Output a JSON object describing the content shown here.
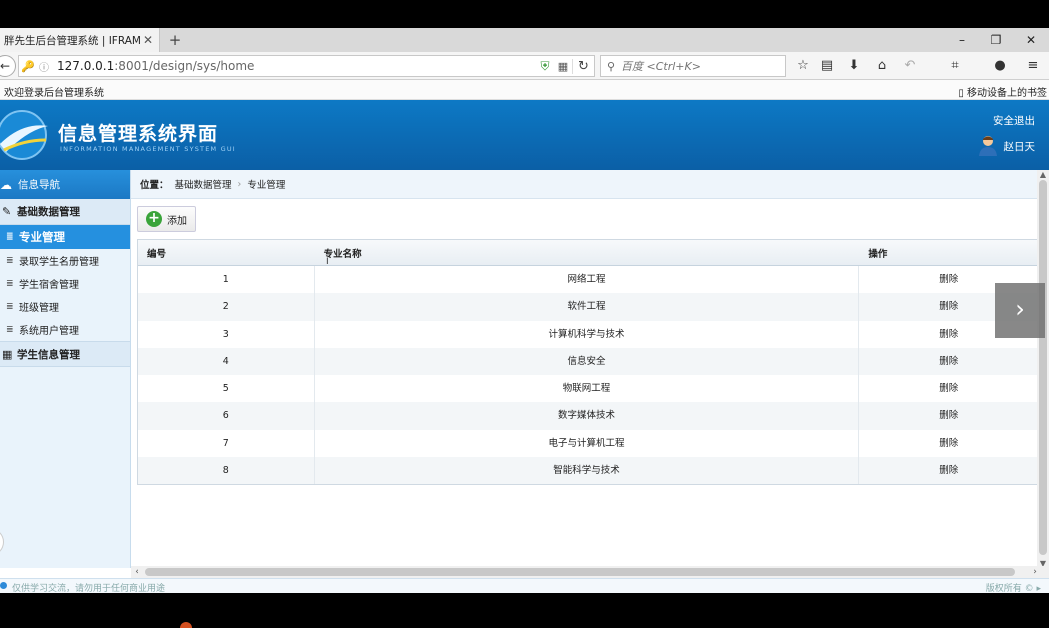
{
  "browser": {
    "tab_title": "胖先生后台管理系统 | IFRAM...",
    "tab_close": "✕",
    "new_tab": "+",
    "window_controls": [
      "–",
      "❐",
      "✕"
    ],
    "url_host": "127.0.0.1",
    "url_rest": ":8001/design/sys/home",
    "search_placeholder": "百度 <Ctrl+K>",
    "bookmark_left": "欢迎登录后台管理系统",
    "bookmark_right": "移动设备上的书签"
  },
  "header": {
    "title": "信息管理系统界面",
    "subtitle": "INFORMATION MANAGEMENT SYSTEM GUI",
    "logout": "安全退出",
    "user_name": "赵日天"
  },
  "sidebar": {
    "nav_title": "信息导航",
    "group1_title": "基础数据管理",
    "items": [
      {
        "label": "专业管理",
        "active": true
      },
      {
        "label": "录取学生名册管理",
        "active": false
      },
      {
        "label": "学生宿舍管理",
        "active": false
      },
      {
        "label": "班级管理",
        "active": false
      },
      {
        "label": "系统用户管理",
        "active": false
      }
    ],
    "group2_title": "学生信息管理"
  },
  "main": {
    "breadcrumb_label": "位置：",
    "breadcrumb_items": [
      "基础数据管理",
      "专业管理"
    ],
    "breadcrumb_sep": "›",
    "add_label": "添加",
    "columns": [
      "编号",
      "专业名称",
      "操作"
    ],
    "rows": [
      {
        "id": "1",
        "name": "网络工程",
        "action": "删除"
      },
      {
        "id": "2",
        "name": "软件工程",
        "action": "删除"
      },
      {
        "id": "3",
        "name": "计算机科学与技术",
        "action": "删除"
      },
      {
        "id": "4",
        "name": "信息安全",
        "action": "删除"
      },
      {
        "id": "5",
        "name": "物联网工程",
        "action": "删除"
      },
      {
        "id": "6",
        "name": "数字媒体技术",
        "action": "删除"
      },
      {
        "id": "7",
        "name": "电子与计算机工程",
        "action": "删除"
      },
      {
        "id": "8",
        "name": "智能科学与技术",
        "action": "删除"
      }
    ]
  },
  "status": {
    "left": "仅供学习交流，请勿用于任何商业用途",
    "right": "版权所有 ©"
  },
  "colors": {
    "header_blue": "#0b6bb6",
    "active_item": "#2590df",
    "add_green": "#3aa43a"
  }
}
